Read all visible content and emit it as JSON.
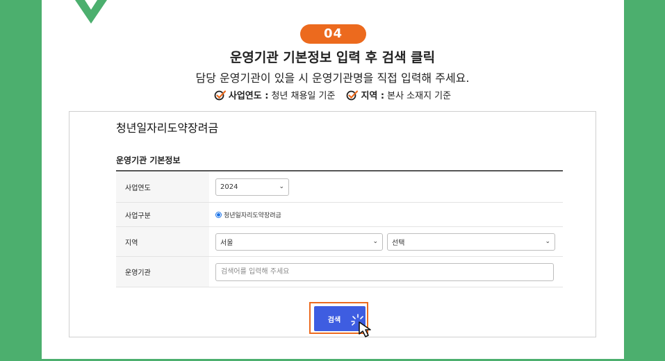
{
  "step": {
    "badge": "04",
    "title": "운영기관 기본정보 입력 후 검색 클릭",
    "subtitle": "담당 운영기관이 있을 시 운영기관명을 직접 입력해 주세요.",
    "notes": [
      {
        "label": "사업연도 :",
        "text": "청년 채용일 기준"
      },
      {
        "label": "지역 :",
        "text": "본사 소재지 기준"
      }
    ]
  },
  "form": {
    "program_title": "청년일자리도약장려금",
    "section_title": "운영기관 기본정보",
    "rows": {
      "year": {
        "label": "사업연도",
        "value": "2024"
      },
      "type": {
        "label": "사업구분",
        "value": "청년일자리도약장려금"
      },
      "region": {
        "label": "지역",
        "value": "서울",
        "sub_value": "선택"
      },
      "agency": {
        "label": "운영기관",
        "placeholder": "검색어를 입력해 주세요"
      }
    },
    "search_label": "검색"
  },
  "colors": {
    "background_green": "#4caf6e",
    "accent_orange": "#ec6a1e",
    "button_blue": "#3e5de1"
  },
  "icons": [
    "check-decoration-icon",
    "check-circle-icon",
    "chevron-down-icon",
    "cursor-icon",
    "click-burst-icon"
  ]
}
